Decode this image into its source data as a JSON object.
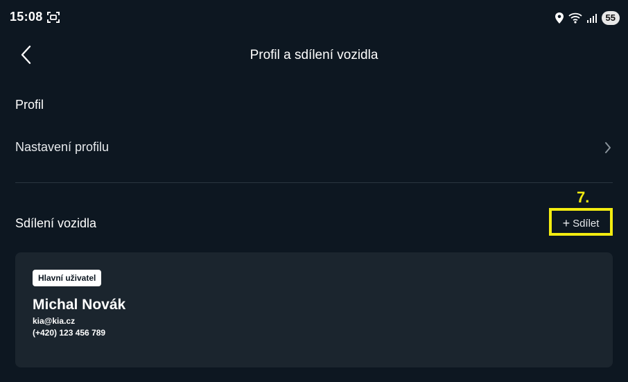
{
  "status_bar": {
    "time": "15:08",
    "battery": "55"
  },
  "header": {
    "title": "Profil a sdílení vozidla"
  },
  "profile": {
    "heading": "Profil",
    "settings_label": "Nastavení profilu"
  },
  "sharing": {
    "heading": "Sdílení vozidla",
    "share_label": "Sdílet",
    "share_plus": "+",
    "step_label": "7.",
    "highlight_color": "#f3ec10"
  },
  "user_card": {
    "role": "Hlavní uživatel",
    "name": "Michal Novák",
    "email": "kia@kia.cz",
    "phone": "(+420) 123 456 789"
  }
}
